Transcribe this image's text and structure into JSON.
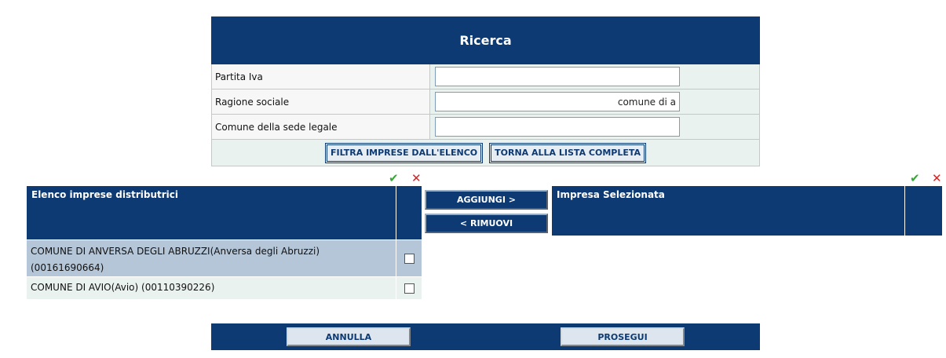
{
  "search": {
    "title": "Ricerca",
    "fields": [
      {
        "label": "Partita Iva",
        "value": ""
      },
      {
        "label": "Ragione sociale",
        "value": "comune di a"
      },
      {
        "label": "Comune della sede legale",
        "value": ""
      }
    ],
    "filter_button": "FILTRA IMPRESE DALL'ELENCO",
    "reset_button": "TORNA ALLA LISTA COMPLETA"
  },
  "icons": {
    "check": "✔",
    "cross": "✕",
    "check_color": "#3aa53a",
    "cross_color": "#e02020"
  },
  "left_list": {
    "title": "Elenco imprese distributrici",
    "items": [
      {
        "label": "COMUNE DI ANVERSA DEGLI ABRUZZI(Anversa degli Abruzzi) (00161690664)",
        "checked": false
      },
      {
        "label": "COMUNE DI AVIO(Avio) (00110390226)",
        "checked": false
      }
    ]
  },
  "middle": {
    "add_button": "AGGIUNGI >",
    "remove_button": "< RIMUOVI"
  },
  "right_panel": {
    "title": "Impresa Selezionata"
  },
  "footer": {
    "cancel_button": "ANNULLA",
    "continue_button": "PROSEGUI"
  },
  "colors": {
    "header_navy": "#0d3a73",
    "row_alt": "#b5c6d8",
    "row_light": "#eaf2ef"
  }
}
